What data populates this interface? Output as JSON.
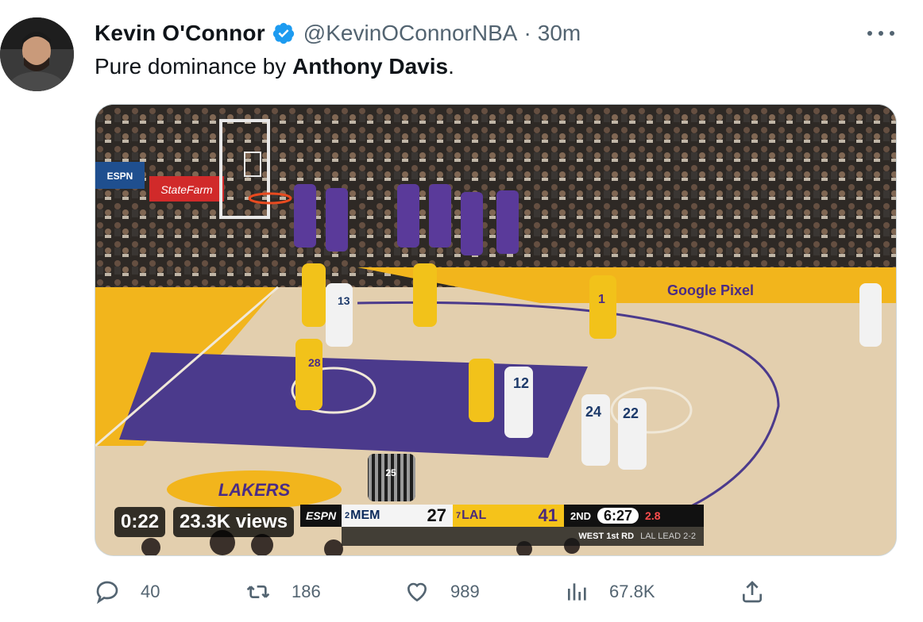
{
  "author": {
    "display_name": "Kevin O'Connor",
    "handle": "@KevinOConnorNBA",
    "separator": "·",
    "time": "30m",
    "verified": true
  },
  "tweet": {
    "text_prefix": "Pure dominance by ",
    "text_bold": "Anthony Davis",
    "text_suffix": "."
  },
  "media": {
    "duration": "0:22",
    "views": "23.3K views",
    "scorebug": {
      "network": "ESPN",
      "away_seed": "2",
      "away_team": "MEM",
      "away_score": "27",
      "home_seed": "7",
      "home_team": "LAL",
      "home_score": "41",
      "quarter": "2ND",
      "clock": "6:27",
      "shot_clock": "2.8",
      "series_info": "WEST 1st RD",
      "series_lead": "LAL LEAD 2-2"
    },
    "arena_signs": {
      "sponsor": "StateFarm",
      "baseline_text": "Google Pixel",
      "scoreboard": "ESPN"
    },
    "jerseys": [
      "13",
      "28",
      "12",
      "24",
      "22",
      "1",
      "25"
    ]
  },
  "actions": {
    "replies": "40",
    "retweets": "186",
    "likes": "989",
    "views": "67.8K"
  },
  "colors": {
    "verified_blue": "#1d9bf0",
    "muted_text": "#536471",
    "lakers_gold": "#f5c31a",
    "lakers_purple": "#4b2c85"
  },
  "icons": [
    "verified-icon",
    "more-icon",
    "reply-icon",
    "retweet-icon",
    "like-icon",
    "views-icon",
    "share-icon"
  ]
}
